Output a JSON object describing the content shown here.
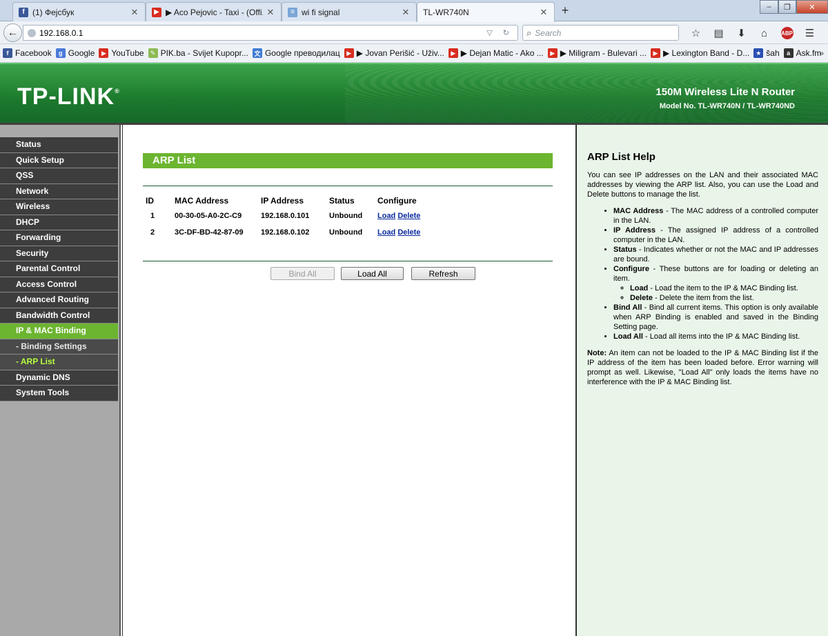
{
  "browser": {
    "tabs": [
      {
        "label": "(1) Фејсбук",
        "icon": "facebook-icon",
        "active": false
      },
      {
        "label": "▶ Aco Pejovic - Taxi - (Offi...",
        "icon": "youtube-icon",
        "active": false
      },
      {
        "label": "wi fi signal",
        "icon": "page-icon",
        "active": false
      },
      {
        "label": "TL-WR740N",
        "icon": "",
        "active": true
      }
    ],
    "new_tab": "+",
    "url": "192.168.0.1",
    "search_placeholder": "Search",
    "bookmarks": [
      {
        "label": "Facebook",
        "icon": "facebook-icon"
      },
      {
        "label": "Google",
        "icon": "google-icon"
      },
      {
        "label": "YouTube",
        "icon": "youtube-icon"
      },
      {
        "label": "PIK.ba - Svijet Kupopr...",
        "icon": "pik-icon"
      },
      {
        "label": "Google преводилац",
        "icon": "translate-icon"
      },
      {
        "label": "▶ Jovan Perišić - Uživ...",
        "icon": "youtube-icon"
      },
      {
        "label": "▶ Dejan Matic - Ako ...",
        "icon": "youtube-icon"
      },
      {
        "label": "▶ Miligram - Bulevari ...",
        "icon": "youtube-icon"
      },
      {
        "label": "▶ Lexington Band - D...",
        "icon": "youtube-icon"
      },
      {
        "label": "šah",
        "icon": "star-icon"
      },
      {
        "label": "Ask.fm",
        "icon": "askfm-icon"
      }
    ],
    "more_bookmarks": "»"
  },
  "header": {
    "logo": "TP-LINK",
    "product": "150M Wireless Lite N Router",
    "model": "Model No. TL-WR740N / TL-WR740ND"
  },
  "menu": {
    "items": [
      {
        "label": "Status",
        "name": "menu-status"
      },
      {
        "label": "Quick Setup",
        "name": "menu-quick-setup"
      },
      {
        "label": "QSS",
        "name": "menu-qss"
      },
      {
        "label": "Network",
        "name": "menu-network"
      },
      {
        "label": "Wireless",
        "name": "menu-wireless"
      },
      {
        "label": "DHCP",
        "name": "menu-dhcp"
      },
      {
        "label": "Forwarding",
        "name": "menu-forwarding"
      },
      {
        "label": "Security",
        "name": "menu-security"
      },
      {
        "label": "Parental Control",
        "name": "menu-parental-control"
      },
      {
        "label": "Access Control",
        "name": "menu-access-control"
      },
      {
        "label": "Advanced Routing",
        "name": "menu-advanced-routing"
      },
      {
        "label": "Bandwidth Control",
        "name": "menu-bandwidth-control"
      },
      {
        "label": "IP & MAC Binding",
        "name": "menu-ip-mac-binding"
      },
      {
        "label": "- Binding Settings",
        "name": "menu-binding-settings"
      },
      {
        "label": "- ARP List",
        "name": "menu-arp-list"
      },
      {
        "label": "Dynamic DNS",
        "name": "menu-dynamic-dns"
      },
      {
        "label": "System Tools",
        "name": "menu-system-tools"
      }
    ]
  },
  "main": {
    "title": "ARP List",
    "columns": [
      "ID",
      "MAC Address",
      "IP Address",
      "Status",
      "Configure"
    ],
    "rows": [
      {
        "id": "1",
        "mac": "00-30-05-A0-2C-C9",
        "ip": "192.168.0.101",
        "status": "Unbound",
        "load": "Load",
        "delete": "Delete"
      },
      {
        "id": "2",
        "mac": "3C-DF-BD-42-87-09",
        "ip": "192.168.0.102",
        "status": "Unbound",
        "load": "Load",
        "delete": "Delete"
      }
    ],
    "buttons": {
      "bind_all": "Bind All",
      "load_all": "Load All",
      "refresh": "Refresh"
    }
  },
  "help": {
    "title": "ARP List Help",
    "intro": "You can see IP addresses on the LAN and their associated MAC addresses by viewing the ARP list. Also, you can use the Load and Delete buttons to manage the list.",
    "items": [
      {
        "term": "MAC Address",
        "desc": " - The MAC address of a controlled computer in the LAN."
      },
      {
        "term": "IP Address",
        "desc": " - The assigned IP address of a controlled computer in the LAN."
      },
      {
        "term": "Status",
        "desc": " - Indicates whether or not the MAC and IP addresses are bound."
      },
      {
        "term": "Configure",
        "desc": " - These buttons are for loading or deleting an item."
      },
      {
        "term": "Bind All",
        "desc": " - Bind all current items. This option is only available when ARP Binding is enabled and saved in the Binding Setting page."
      },
      {
        "term": "Load All",
        "desc": " - Load all items into the IP & MAC Binding list."
      }
    ],
    "subitems": [
      {
        "term": "Load",
        "desc": " - Load the item to the IP & MAC Binding list."
      },
      {
        "term": "Delete",
        "desc": " - Delete the item from the list."
      }
    ],
    "note_label": "Note:",
    "note": " An item can not be loaded to the IP & MAC Binding list if the IP address of the item has been loaded before. Error warning will prompt as well. Likewise, \"Load All\" only loads the items have no interference with the IP & MAC Binding list."
  }
}
